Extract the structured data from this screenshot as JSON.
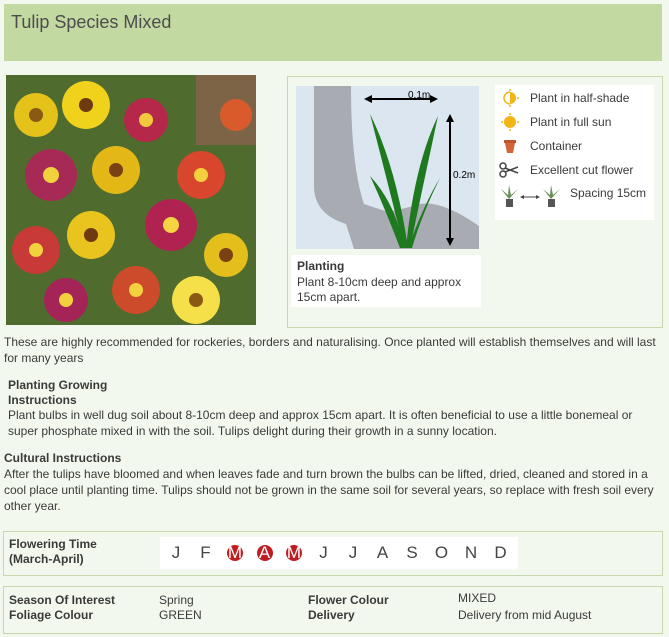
{
  "title": "Tulip Species Mixed",
  "diagram": {
    "width_label": "0.1m",
    "height_label": "0.2m"
  },
  "planting": {
    "title": "Planting",
    "text": "Plant 8-10cm deep and approx 15cm apart."
  },
  "legend": [
    {
      "icon": "half-sun-icon",
      "label": "Plant in half-shade"
    },
    {
      "icon": "sun-icon",
      "label": "Plant in full sun"
    },
    {
      "icon": "pot-icon",
      "label": "Container"
    },
    {
      "icon": "scissors-icon",
      "label": "Excellent cut flower"
    },
    {
      "icon": "spacing-icon",
      "label": "Spacing 15cm"
    }
  ],
  "description": "These are highly recommended for rockeries, borders and naturalising. Once planted will establish themselves and will last for many years",
  "growing": {
    "heading_line1": "Planting Growing",
    "heading_line2": "Instructions",
    "text": "Plant bulbs in well dug soil about 8-10cm deep and approx 15cm apart. It is often beneficial to use a little bonemeal or super phosphate mixed in with the soil. Tulips delight during their growth in a sunny location."
  },
  "cultural": {
    "heading": "Cultural Instructions",
    "text": "After the tulips have bloomed and when leaves fade and turn brown the bulbs can be lifted, dried, cleaned and stored in a cool place until planting time. Tulips should not be grown in the same soil for several years, so replace with fresh soil every other year."
  },
  "flowering": {
    "label_line1": "Flowering Time",
    "label_line2": "(March-April)",
    "months": [
      {
        "l": "J",
        "on": false
      },
      {
        "l": "F",
        "on": false
      },
      {
        "l": "M",
        "on": true
      },
      {
        "l": "A",
        "on": true
      },
      {
        "l": "M",
        "on": true
      },
      {
        "l": "J",
        "on": false
      },
      {
        "l": "J",
        "on": false
      },
      {
        "l": "A",
        "on": false
      },
      {
        "l": "S",
        "on": false
      },
      {
        "l": "O",
        "on": false
      },
      {
        "l": "N",
        "on": false
      },
      {
        "l": "D",
        "on": false
      }
    ]
  },
  "attributes": {
    "season_key": "Season Of Interest",
    "season_val": "Spring",
    "foliage_key": "Foliage Colour",
    "foliage_val": "GREEN",
    "flower_key": "Flower Colour",
    "flower_val": "MIXED",
    "delivery_key": "Delivery",
    "delivery_val": "Delivery from mid August"
  },
  "colors": {
    "header": "#c3d9a2",
    "background": "#f3f8ee",
    "month_highlight": "#c01d22",
    "leaf": "#1f7a1f"
  }
}
